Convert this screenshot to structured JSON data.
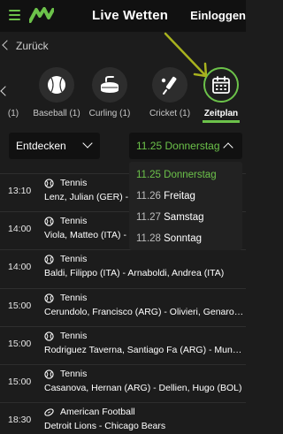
{
  "header": {
    "title": "Live Wetten",
    "login_label": "Einloggen"
  },
  "nav": {
    "back_label": "Zurück"
  },
  "sports": [
    {
      "label": "(1)",
      "icon": "partial-icon"
    },
    {
      "label": "Baseball (1)",
      "icon": "baseball-icon"
    },
    {
      "label": "Curling (1)",
      "icon": "curling-stone-icon"
    },
    {
      "label": "Cricket (1)",
      "icon": "cricket-bat-icon"
    },
    {
      "label": "Zeitplan",
      "icon": "calendar-icon",
      "active": true
    }
  ],
  "filters": {
    "discover_label": "Entdecken",
    "date_selected": "11.25 Donnerstag"
  },
  "date_menu": [
    {
      "num": "11.25",
      "day": "Donnerstag",
      "selected": true
    },
    {
      "num": "11.26",
      "day": "Freitag"
    },
    {
      "num": "11.27",
      "day": "Samstag"
    },
    {
      "num": "11.28",
      "day": "Sonntag"
    }
  ],
  "events": [
    {
      "time": "13:10",
      "sport": "Tennis",
      "teams": "Lenz, Julian (GER) - Na"
    },
    {
      "time": "14:00",
      "sport": "Tennis",
      "teams": "Viola, Matteo (ITA) - C"
    },
    {
      "time": "14:00",
      "sport": "Tennis",
      "teams": "Baldi, Filippo (ITA) - Arnaboldi, Andrea (ITA)"
    },
    {
      "time": "15:00",
      "sport": "Tennis",
      "teams": "Cerundolo, Francisco (ARG) - Olivieri, Genaro Alber..."
    },
    {
      "time": "15:00",
      "sport": "Tennis",
      "teams": "Rodriguez Taverna, Santiago Fa (ARG) - Munar, Jau..."
    },
    {
      "time": "15:00",
      "sport": "Tennis",
      "teams": "Casanova, Hernan (ARG) - Dellien, Hugo (BOL)"
    },
    {
      "time": "18:30",
      "sport": "American Football",
      "teams": "Detroit Lions - Chicago Bears"
    }
  ],
  "colors": {
    "accent": "#6cc24a",
    "background": "#1c1c1c",
    "header": "#111111",
    "annotation": "#a8b21e"
  }
}
